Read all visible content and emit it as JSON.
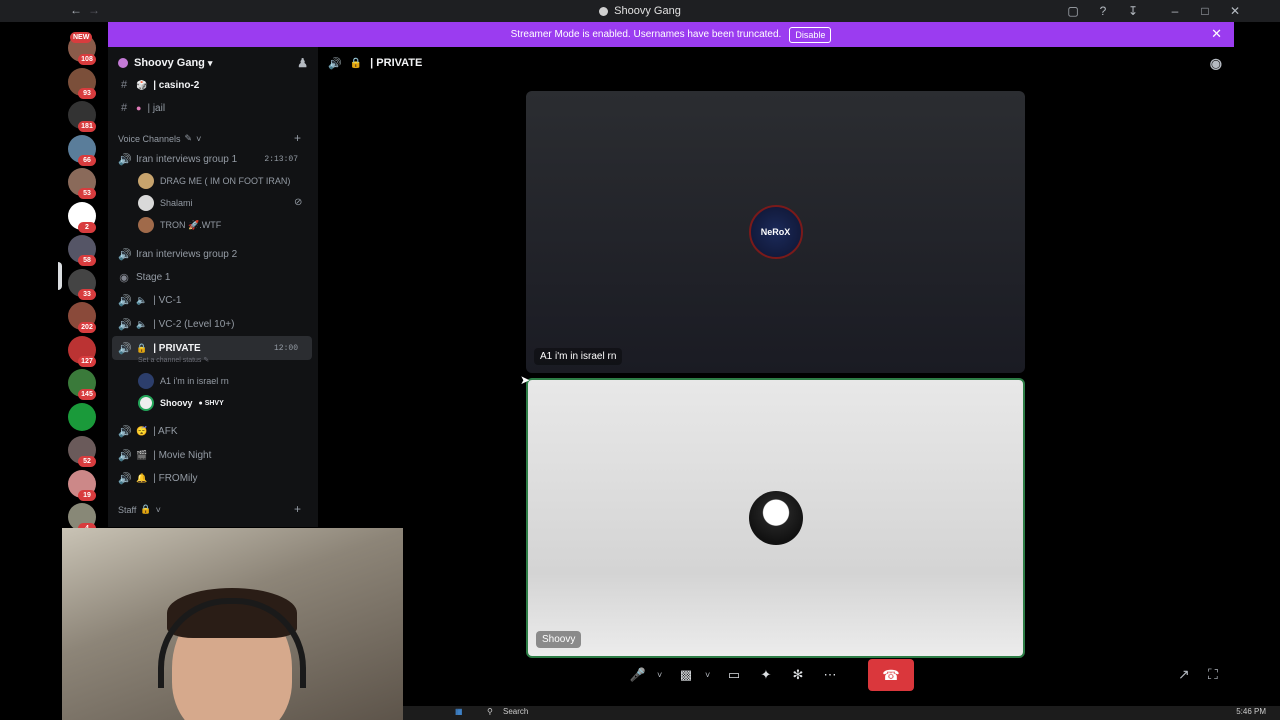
{
  "window": {
    "title": "Shoovy Gang",
    "clock": "5:46 PM"
  },
  "banner": {
    "text": "Streamer Mode is enabled. Usernames have been truncated.",
    "button": "Disable"
  },
  "servers": [
    {
      "badge": "108",
      "new": "NEW"
    },
    {
      "badge": "93"
    },
    {
      "badge": "181"
    },
    {
      "badge": "66"
    },
    {
      "badge": "53"
    },
    {
      "badge": "2"
    },
    {
      "badge": "58"
    },
    {
      "badge": "33"
    },
    {
      "badge": "202"
    },
    {
      "badge": "127"
    },
    {
      "badge": "145"
    },
    {
      "badge": ""
    },
    {
      "badge": "52"
    },
    {
      "badge": "19"
    },
    {
      "badge": "4"
    }
  ],
  "guild": {
    "name": "Shoovy Gang"
  },
  "channels": {
    "text1": "| casino-2",
    "text2": "| jail",
    "voice_category": "Voice Channels",
    "vc1": "Iran interviews group 1",
    "vc1_time": "2:13:07",
    "vc1_users": [
      "DRAG ME ( IM ON FOOT IRAN)",
      "Shalami",
      "TRON  🚀.WTF"
    ],
    "vc2": "Iran interviews group 2",
    "stage": "Stage 1",
    "vcA": "| VC-1",
    "vcB": "| VC-2 (Level 10+)",
    "private": "| PRIVATE",
    "private_time": "12:00",
    "private_status": "Set a channel status",
    "private_users": [
      "A1 i'm in israel rn",
      "Shoovy"
    ],
    "shoovy_tag": "SHVY",
    "afk": "| AFK",
    "movie": "| Movie Night",
    "fromily": "| FROMily",
    "staff": "Staff"
  },
  "main": {
    "channel_title": "| PRIVATE",
    "tile1_name": "A1 i'm in israel rn",
    "tile1_avatar_text": "NeRoX",
    "tile2_name": "Shoovy"
  },
  "taskbar": {
    "search": "Search"
  }
}
